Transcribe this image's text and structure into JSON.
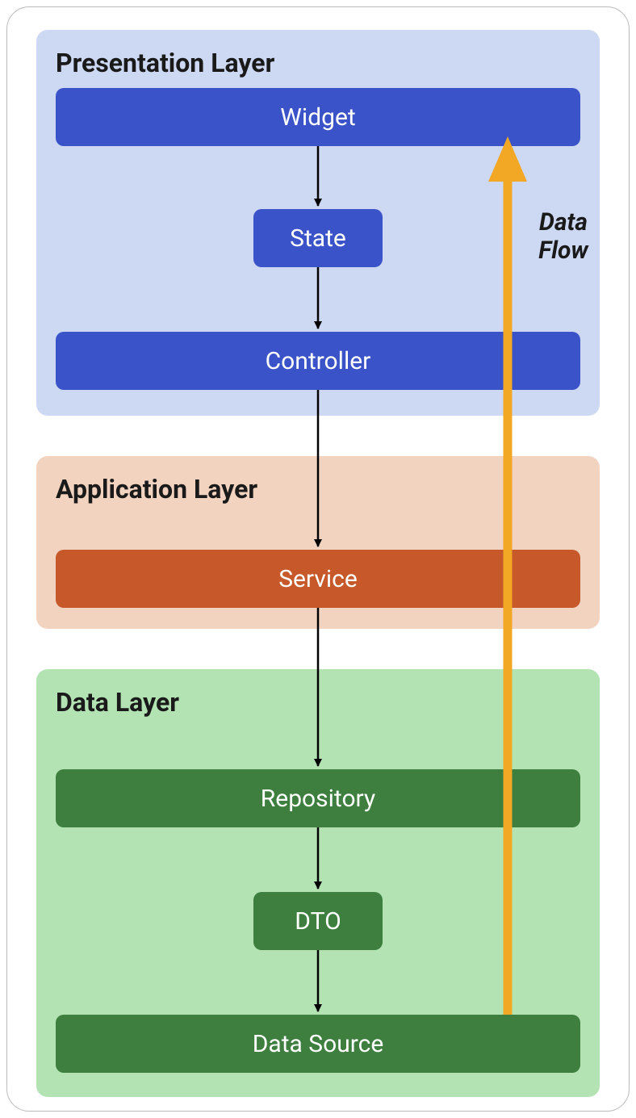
{
  "layers": {
    "presentation": {
      "title": "Presentation Layer",
      "boxes": {
        "widget": "Widget",
        "state": "State",
        "controller": "Controller"
      },
      "bg": "#cdd8f3",
      "box_color": "#3b53c8"
    },
    "application": {
      "title": "Application Layer",
      "boxes": {
        "service": "Service"
      },
      "bg": "#f2d3c0",
      "box_color": "#c6582a"
    },
    "data": {
      "title": "Data Layer",
      "boxes": {
        "repository": "Repository",
        "dto": "DTO",
        "datasource": "Data Source"
      },
      "bg": "#b3e3b3",
      "box_color": "#3e7f3f"
    }
  },
  "flow_label": "Data\nFlow",
  "flow_arrow_color": "#f2a725",
  "connector_color": "#000000"
}
